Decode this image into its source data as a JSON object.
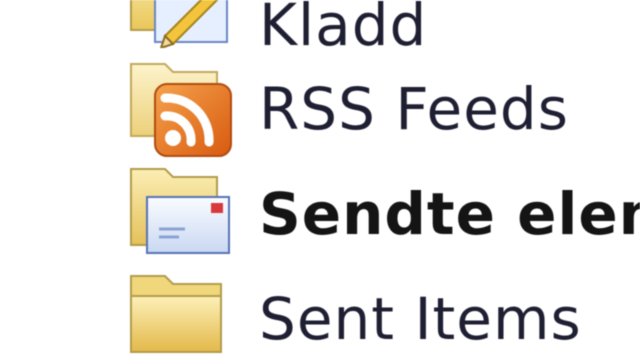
{
  "folder_list": {
    "items": [
      {
        "label": "Kladd",
        "bold": false,
        "icon": "drafts-folder-icon"
      },
      {
        "label": "RSS Feeds",
        "bold": false,
        "icon": "rss-folder-icon"
      },
      {
        "label": "Sendte elementer",
        "bold": true,
        "icon": "sent-mail-folder-icon"
      },
      {
        "label": "Sent Items",
        "bold": false,
        "icon": "folder-icon"
      }
    ]
  },
  "colors": {
    "folder_yellow": "#f6dc82",
    "rss_orange": "#e8701e",
    "text": "#1f1f33"
  }
}
